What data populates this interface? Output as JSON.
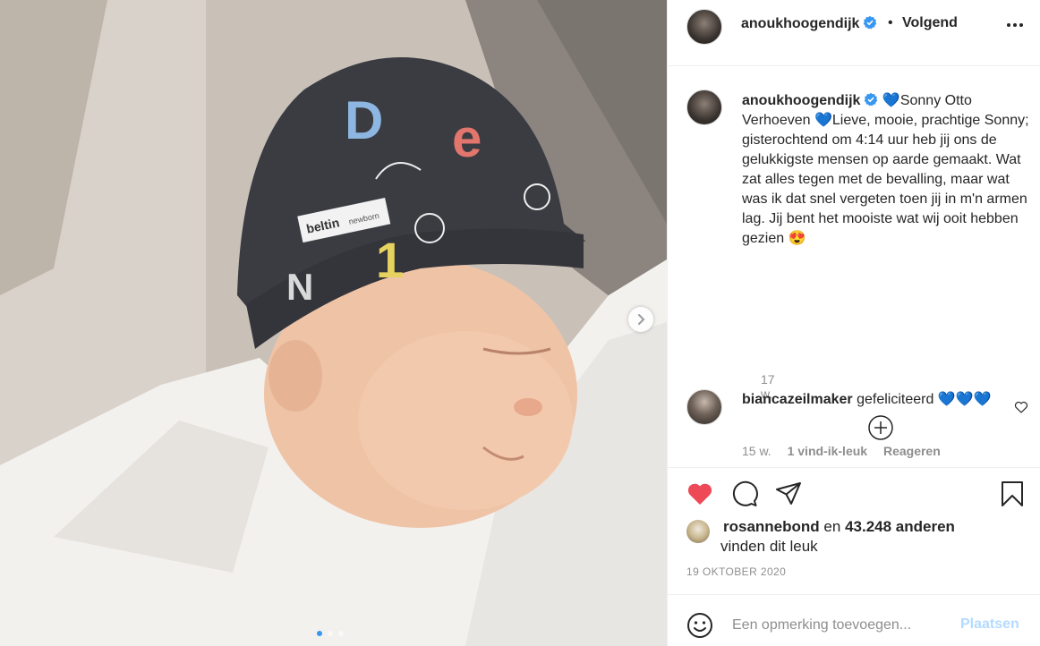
{
  "post": {
    "images_count": 3,
    "active_image": 1,
    "photo_labels": {
      "hat_brand": "beltin",
      "hat_sub": "newborn"
    }
  },
  "header": {
    "username": "anoukhoogendijk",
    "dot": "•",
    "follow_label": "Volgend"
  },
  "caption": {
    "username": "anoukhoogendijk",
    "text_1": "💙Sonny Otto Verhoeven 💙Lieve, mooie, prachtige Sonny; gisterochtend om 4:14 uur heb jij ons de gelukkigste mensen op aarde gemaakt. Wat zat alles tegen met de bevalling, maar wat was ik dat snel vergeten toen jij in m'n armen lag. Jij bent het mooiste wat wij ooit hebben gezien 😍",
    "age": "17 w."
  },
  "comments": [
    {
      "username": "biancazeilmaker",
      "text": "gefeliciteerd 💙💙💙",
      "age": "15 w.",
      "likes": "1 vind-ik-leuk",
      "reply_label": "Reageren"
    }
  ],
  "likes": {
    "first_user": "rosannebond",
    "connector": "en",
    "others": "43.248 anderen",
    "suffix": "vinden dit leuk"
  },
  "date": "19 OKTOBER 2020",
  "composer": {
    "placeholder": "Een opmerking toevoegen...",
    "post_label": "Plaatsen"
  },
  "colors": {
    "verified": "#3897f0",
    "liked_heart": "#ed4956",
    "post_disabled": "#b3dbff",
    "active_dot": "#3897f0"
  }
}
